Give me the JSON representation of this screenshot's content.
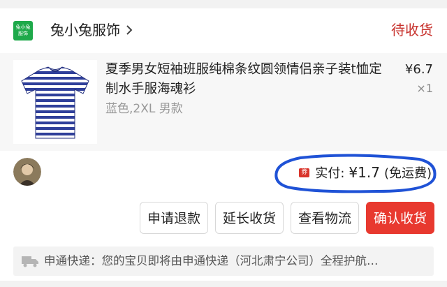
{
  "shop": {
    "logo_line1": "兔小兔",
    "logo_line2": "服饰",
    "name": "兔小兔服饰",
    "status": "待收货"
  },
  "product": {
    "title": "夏季男女短袖班服纯棉条纹圆领情侣亲子装t恤定制水手服海魂衫",
    "sku": "蓝色,2XL 男款",
    "price": "¥6.7",
    "quantity": "×1"
  },
  "total": {
    "coupon": "券",
    "label": "实付:",
    "amount": "¥1.7",
    "shipping": "(免运费)"
  },
  "actions": {
    "refund": "申请退款",
    "extend": "延长收货",
    "logistics": "查看物流",
    "confirm": "确认收货"
  },
  "logistics": {
    "text": "申通快递：您的宝贝即将由申通快递（河北肃宁公司）全程护航…"
  },
  "colors": {
    "accent_red": "#e8392f",
    "status_red": "#c7302b",
    "logo_green": "#1ea94a",
    "annotation_blue": "#1f52d6"
  },
  "icons": {
    "shop_chevron": "chevron-right-icon",
    "truck": "truck-icon"
  }
}
